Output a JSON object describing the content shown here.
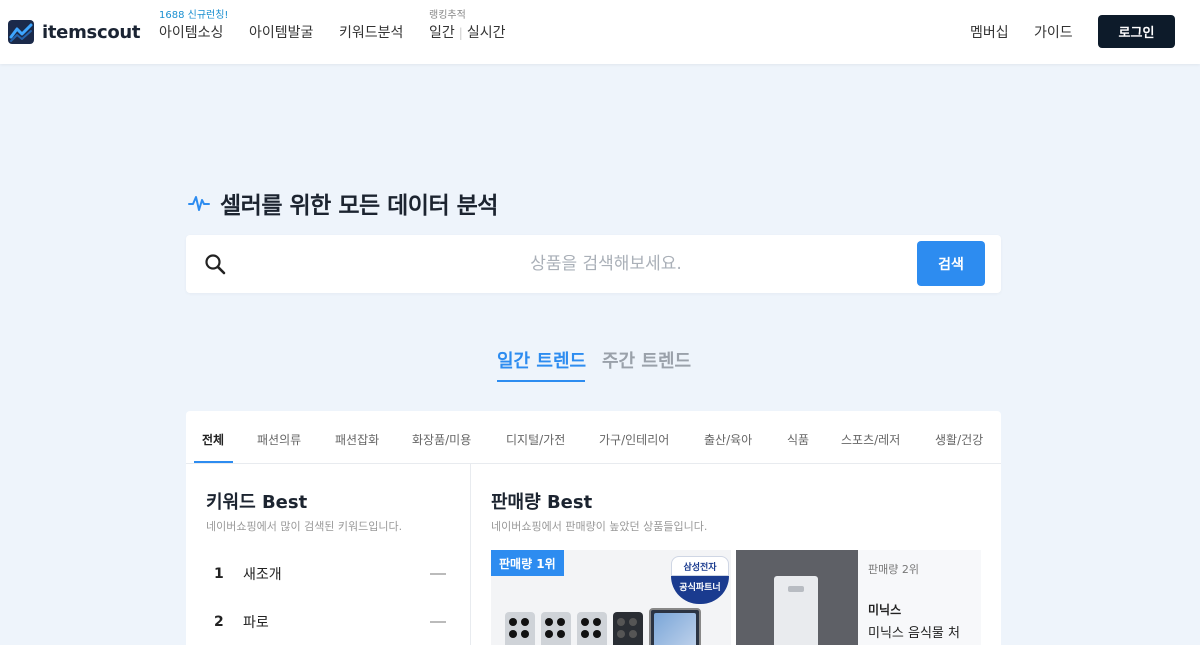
{
  "header": {
    "logo_text": "itemscout",
    "nav": [
      {
        "label": "아이템소싱",
        "badge": "1688 신규런칭!"
      },
      {
        "label": "아이템발굴"
      },
      {
        "label": "키워드분석"
      }
    ],
    "ranking": {
      "caption": "랭킹추적",
      "daily": "일간",
      "realtime": "실시간"
    },
    "right_nav": [
      "멤버십",
      "가이드"
    ],
    "login_label": "로그인"
  },
  "hero": {
    "title": "셀러를 위한 모든 데이터 분석",
    "search_placeholder": "상품을 검색해보세요.",
    "search_button": "검색"
  },
  "trend_tabs": [
    {
      "label": "일간 트렌드",
      "active": true
    },
    {
      "label": "주간 트렌드",
      "active": false
    }
  ],
  "categories": [
    "전체",
    "패션의류",
    "패션잡화",
    "화장품/미용",
    "디지털/가전",
    "가구/인테리어",
    "출산/육아",
    "식품",
    "스포츠/레저",
    "생활/건강"
  ],
  "keyword_best": {
    "title": "키워드 Best",
    "subtitle": "네이버쇼핑에서 많이 검색된 키워드입니다.",
    "items": [
      {
        "rank": "1",
        "keyword": "새조개"
      },
      {
        "rank": "2",
        "keyword": "파로"
      }
    ]
  },
  "sales_best": {
    "title": "판매량 Best",
    "subtitle": "네이버쇼핑에서 판매량이 높았던 상품들입니다.",
    "first": {
      "badge": "판매량 1위",
      "partner_top": "삼성전자",
      "partner_bottom": "공식파트너"
    },
    "second": {
      "rank_label": "판매량 2위",
      "brand": "미닉스",
      "name": "미닉스 음식물 처"
    }
  },
  "colors": {
    "accent": "#2d8cf0",
    "login_bg": "#0d1b2a",
    "page_bg": "#eef4fb"
  }
}
